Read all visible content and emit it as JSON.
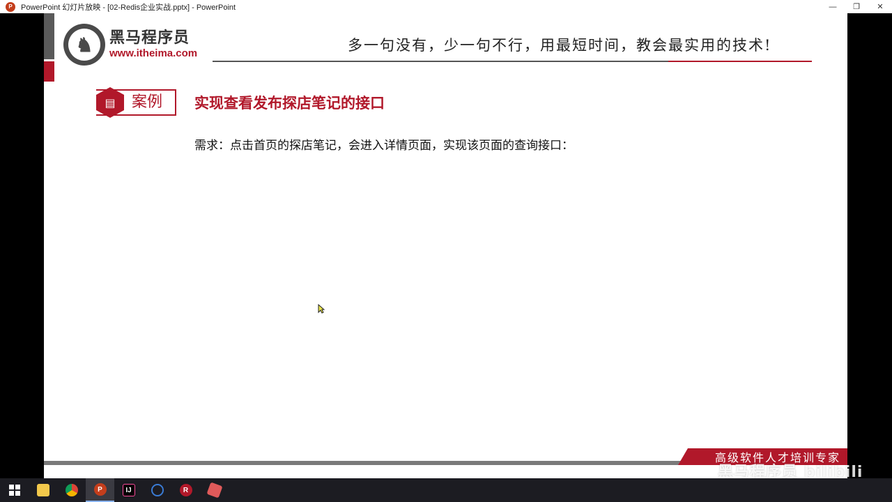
{
  "window": {
    "title": "PowerPoint 幻灯片放映 - [02-Redis企业实战.pptx] - PowerPoint",
    "minimize": "—",
    "restore": "❐",
    "close": "✕"
  },
  "slide": {
    "logo": {
      "name": "黑马程序员",
      "url": "www.itheima.com"
    },
    "slogan": "多一句没有，少一句不行，用最短时间，教会最实用的技术!",
    "case_label": "案例",
    "case_title": "实现查看发布探店笔记的接口",
    "requirement": "需求：点击首页的探店笔记，会进入详情页面，实现该页面的查询接口：",
    "footer": "高级软件人才培训专家"
  },
  "watermark": "黑马程序员 bilibili",
  "taskbar": {
    "items": [
      {
        "name": "windows-start",
        "color": "#ffffff"
      },
      {
        "name": "file-explorer",
        "color": "#f2c84b"
      },
      {
        "name": "chrome",
        "color": "#4285f4"
      },
      {
        "name": "powerpoint",
        "color": "#c43e1c",
        "active": true
      },
      {
        "name": "intellij-idea",
        "color": "#000000"
      },
      {
        "name": "browser-app",
        "color": "#3a7bd5"
      },
      {
        "name": "redis-desktop",
        "color": "#b1182a"
      },
      {
        "name": "another-app",
        "color": "#e05a5a"
      }
    ]
  },
  "colors": {
    "brand_red": "#b1182a",
    "taskbar_bg": "#1c1c22"
  }
}
